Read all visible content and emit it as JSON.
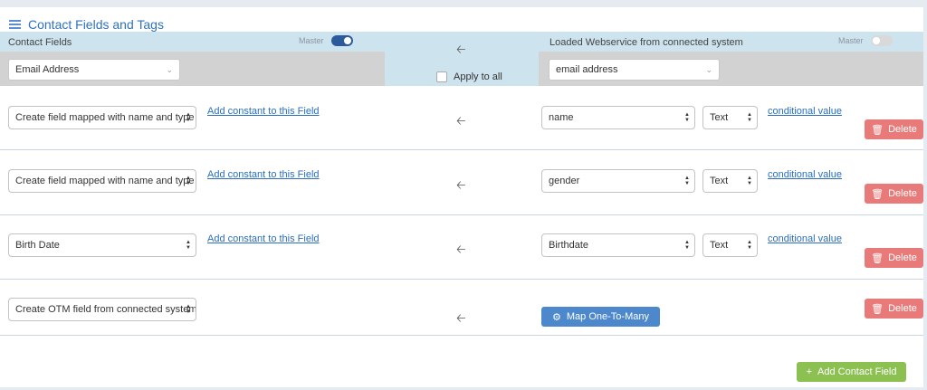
{
  "panel": {
    "title": "Contact Fields and Tags",
    "icon": "list-icon"
  },
  "header": {
    "left_label": "Contact Fields",
    "master_label": "Master",
    "left_master_on": true,
    "email_select": "Email Address",
    "apply_all_label": "Apply to all",
    "right_label": "Loaded Webservice from connected system",
    "right_master_label": "Master",
    "right_master_on": false,
    "right_email_select": "email address"
  },
  "rows": [
    {
      "field": "Create field mapped with name and type",
      "constant_link": "Add constant to this Field",
      "source": "name",
      "type": "Text",
      "conditional_link": "conditional value",
      "delete_label": "Delete"
    },
    {
      "field": "Create field mapped with name and type",
      "constant_link": "Add constant to this Field",
      "source": "gender",
      "type": "Text",
      "conditional_link": "conditional value",
      "delete_label": "Delete"
    },
    {
      "field": "Birth Date",
      "constant_link": "Add constant to this Field",
      "source": "Birthdate",
      "type": "Text",
      "conditional_link": "conditional value",
      "delete_label": "Delete"
    }
  ],
  "otm_row": {
    "field": "Create OTM field from connected system",
    "map_label": "Map One-To-Many",
    "delete_label": "Delete"
  },
  "footer": {
    "add_label": "Add Contact Field"
  },
  "colors": {
    "link": "#2a6ebd",
    "delete": "#e87a7a",
    "map": "#4d88cd",
    "add": "#8cc152",
    "header_blue": "#cde3ee"
  }
}
